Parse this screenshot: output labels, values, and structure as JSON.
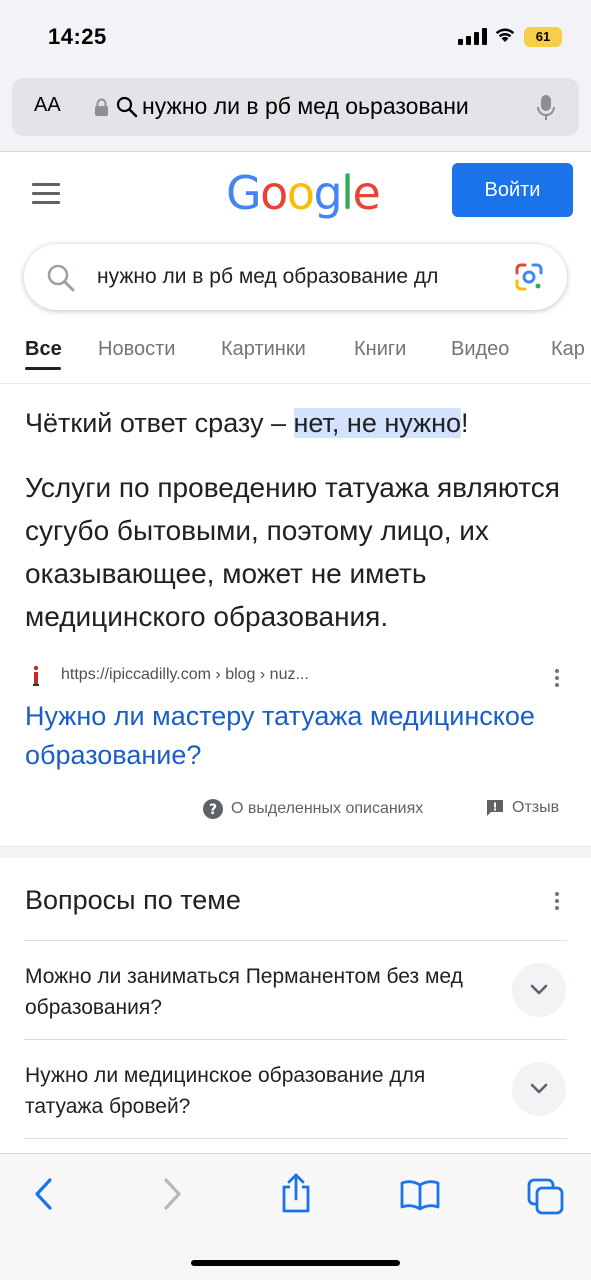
{
  "status_bar": {
    "time": "14:25",
    "battery": "61"
  },
  "browser": {
    "aa_label": "AA",
    "url_text": "нужно ли в рб мед оьразовани",
    "icons": [
      "lock-icon",
      "search-icon",
      "mic-icon"
    ]
  },
  "google": {
    "logo": "Google",
    "signin_label": "Войти",
    "search_query": "нужно ли в рб мед образование дл",
    "tabs": [
      "Все",
      "Новости",
      "Картинки",
      "Книги",
      "Видео",
      "Кар"
    ],
    "active_tab": "Все"
  },
  "featured_snippet": {
    "intro_before": "Чёткий ответ сразу – ",
    "intro_highlight": "нет, не нужно",
    "intro_after": "!",
    "body": "Услуги по проведению татуажа являются сугубо бытовыми, поэтому лицо, их оказывающее, может не иметь медицинского образования.",
    "source_url": "https://ipiccadilly.com › blog › nuz...",
    "title": "Нужно ли мастеру татуажа медицинское образование?",
    "about_label": "О выделенных описаниях",
    "feedback_label": "Отзыв"
  },
  "people_also_ask": {
    "title": "Вопросы по теме",
    "questions": [
      "Можно ли заниматься Перманентом без мед образования?",
      "Нужно ли медицинское образование для татуажа бровей?"
    ]
  },
  "colors": {
    "accent": "#1a73e8",
    "link": "#1a5fc8",
    "highlight": "#d3e3fd",
    "battery": "#f7ce46",
    "ios_blue": "#1a73e8"
  }
}
